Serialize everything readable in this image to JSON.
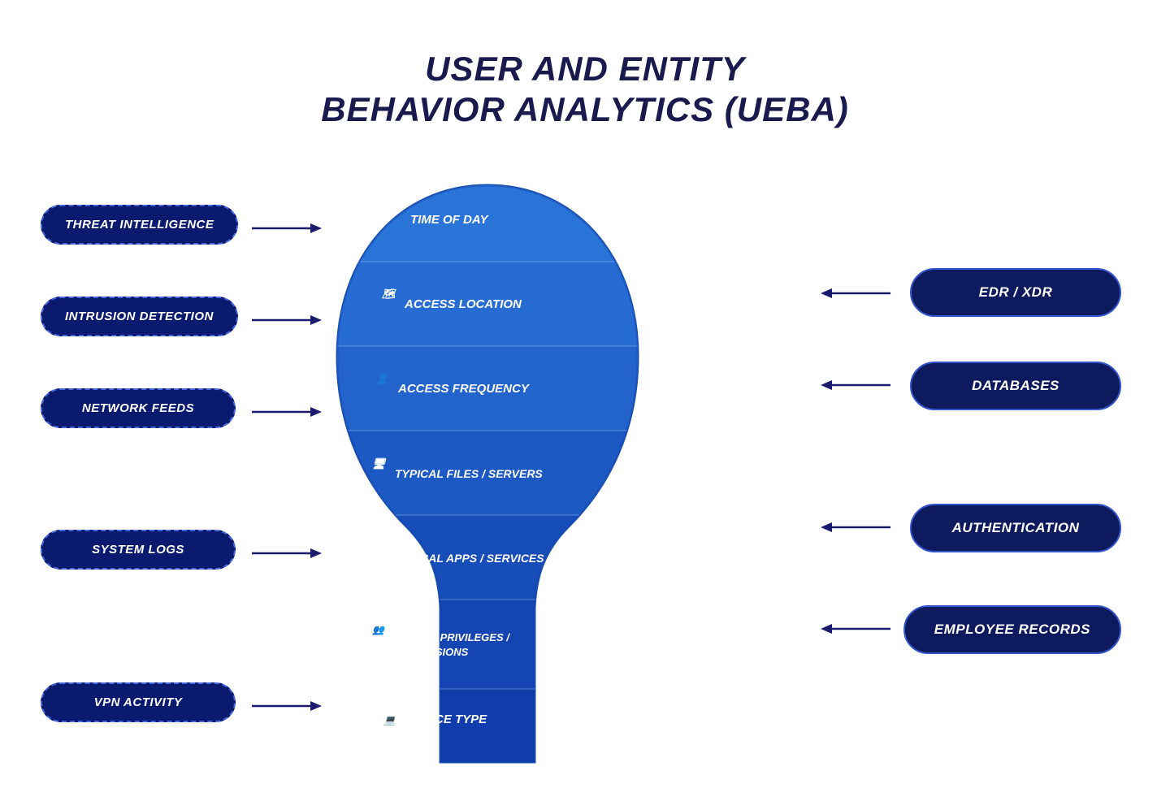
{
  "title": {
    "line1": "USER AND ENTITY",
    "line2": "BEHAVIOR ANALYTICS (UEBA)"
  },
  "left_pills": [
    {
      "id": "threat-intelligence",
      "label": "THREAT INTELLIGENCE"
    },
    {
      "id": "intrusion-detection",
      "label": "INTRUSION DETECTION"
    },
    {
      "id": "network-feeds",
      "label": "NETWORK FEEDS"
    },
    {
      "id": "system-logs",
      "label": "SYSTEM LOGS"
    },
    {
      "id": "vpn-activity",
      "label": "VPN ACTIVITY"
    }
  ],
  "right_pills": [
    {
      "id": "edr-xdr",
      "label": "EDR / XDR"
    },
    {
      "id": "databases",
      "label": "DATABASES"
    },
    {
      "id": "authentication",
      "label": "AUTHENTICATION"
    },
    {
      "id": "employee-records",
      "label": "EMPLOYEE RECORDS"
    }
  ],
  "center_rows": [
    {
      "id": "time-of-day",
      "label": "TIME OF DAY",
      "icon": "⏱"
    },
    {
      "id": "access-location",
      "label": "ACCESS LOCATION",
      "icon": "🗺"
    },
    {
      "id": "access-frequency",
      "label": "ACCESS FREQUENCY",
      "icon": "👤"
    },
    {
      "id": "typical-files-servers",
      "label": "TYPICAL FILES / SERVERS",
      "icon": "🖥"
    },
    {
      "id": "typical-apps-services",
      "label": "TYPICAL APPS / SERVICES",
      "icon": "🖥"
    },
    {
      "id": "roles-privileges",
      "label": "ROLES / PRIVILEGES /\nPERMISSIONS",
      "icon": "👥"
    },
    {
      "id": "device-type",
      "label": "DEVICE TYPE",
      "icon": "💻"
    }
  ],
  "colors": {
    "dark_navy": "#0a1a6e",
    "accent_blue": "#1e5fdc",
    "white": "#ffffff"
  }
}
